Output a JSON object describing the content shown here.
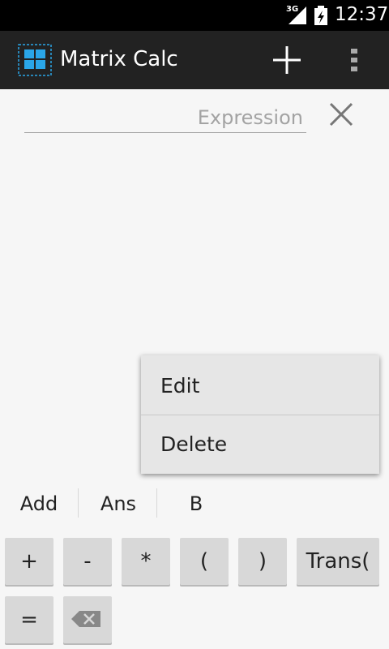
{
  "status_bar": {
    "network": "3G",
    "time": "12:37"
  },
  "app": {
    "title": "Matrix Calc",
    "accent": "#2aa6e8"
  },
  "expression": {
    "placeholder": "Expression",
    "value": ""
  },
  "context_menu": {
    "items": [
      "Edit",
      "Delete"
    ]
  },
  "variables": [
    "Add",
    "Ans",
    "B"
  ],
  "keypad": {
    "row1": [
      "+",
      "-",
      "*",
      "(",
      ")",
      "Trans("
    ],
    "row2": [
      "="
    ],
    "backspace_icon": "backspace-icon"
  }
}
